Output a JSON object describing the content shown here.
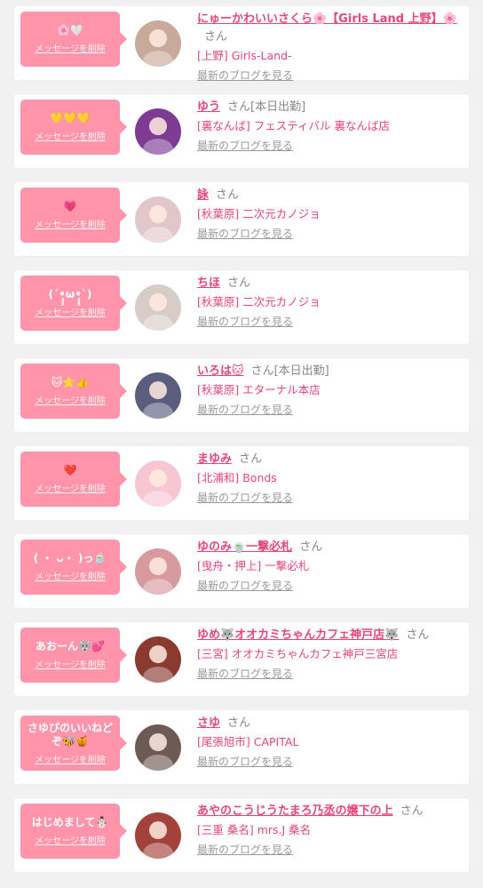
{
  "ui": {
    "delete_label": "メッセージを削除",
    "blog_label": "最新のブログを見る",
    "san": "さん"
  },
  "items": [
    {
      "message": "🌸🤍",
      "name": "にゅーかわいいさくら🌸【Girls Land 上野】🌸",
      "status": "",
      "shop": "[上野] Girls-Land-",
      "avatar_color": "#c9a99a"
    },
    {
      "message": "💛💛💛",
      "name": "ゆう",
      "status": "[本日出勤]",
      "shop": "[裏なんば] フェスティバル 裏なんば店",
      "avatar_color": "#7d3b94"
    },
    {
      "message": "💗",
      "name": "詠",
      "status": "",
      "shop": "[秋葉原] 二次元カノジョ",
      "avatar_color": "#e2c6c9"
    },
    {
      "message": "(´•̥̥̥ω•̥̥̥`)",
      "name": "ちほ",
      "status": "",
      "shop": "[秋葉原] 二次元カノジョ",
      "avatar_color": "#d8ccc6"
    },
    {
      "message": "🐱⭐👍",
      "name": "いろは🐱",
      "status": "[本日出勤]",
      "shop": "[秋葉原] エターナル本店",
      "avatar_color": "#5a5e7e"
    },
    {
      "message": "❤️",
      "name": "まゆみ",
      "status": "",
      "shop": "[北浦和] Bonds",
      "avatar_color": "#f6c7d3"
    },
    {
      "message": "(  ・ ᴗ・ )っ🍵",
      "name": "ゆのみ🍵一撃必札",
      "status": "",
      "shop": "[曳舟・押上] 一撃必札",
      "avatar_color": "#d79a9e"
    },
    {
      "message": "あおーん🐺💕",
      "name": "ゆめ🐺オオカミちゃんカフェ神戸店🐺",
      "status": "",
      "shop": "[三宮] オオカミちゃんカフェ神戸三宮店",
      "avatar_color": "#8a3a2e"
    },
    {
      "message": "さゆぴのいいねど\nぞ🐝🍯",
      "name": "さゆ",
      "status": "",
      "shop": "[尾張旭市] CAPITAL",
      "avatar_color": "#6e5a55"
    },
    {
      "message": "はじめまして⛄",
      "name": "あやのこうじうたまろ乃丞の嬢下の上",
      "status": "",
      "shop": "[三重 桑名] mrs.J 桑名",
      "avatar_color": "#a3423a"
    }
  ]
}
